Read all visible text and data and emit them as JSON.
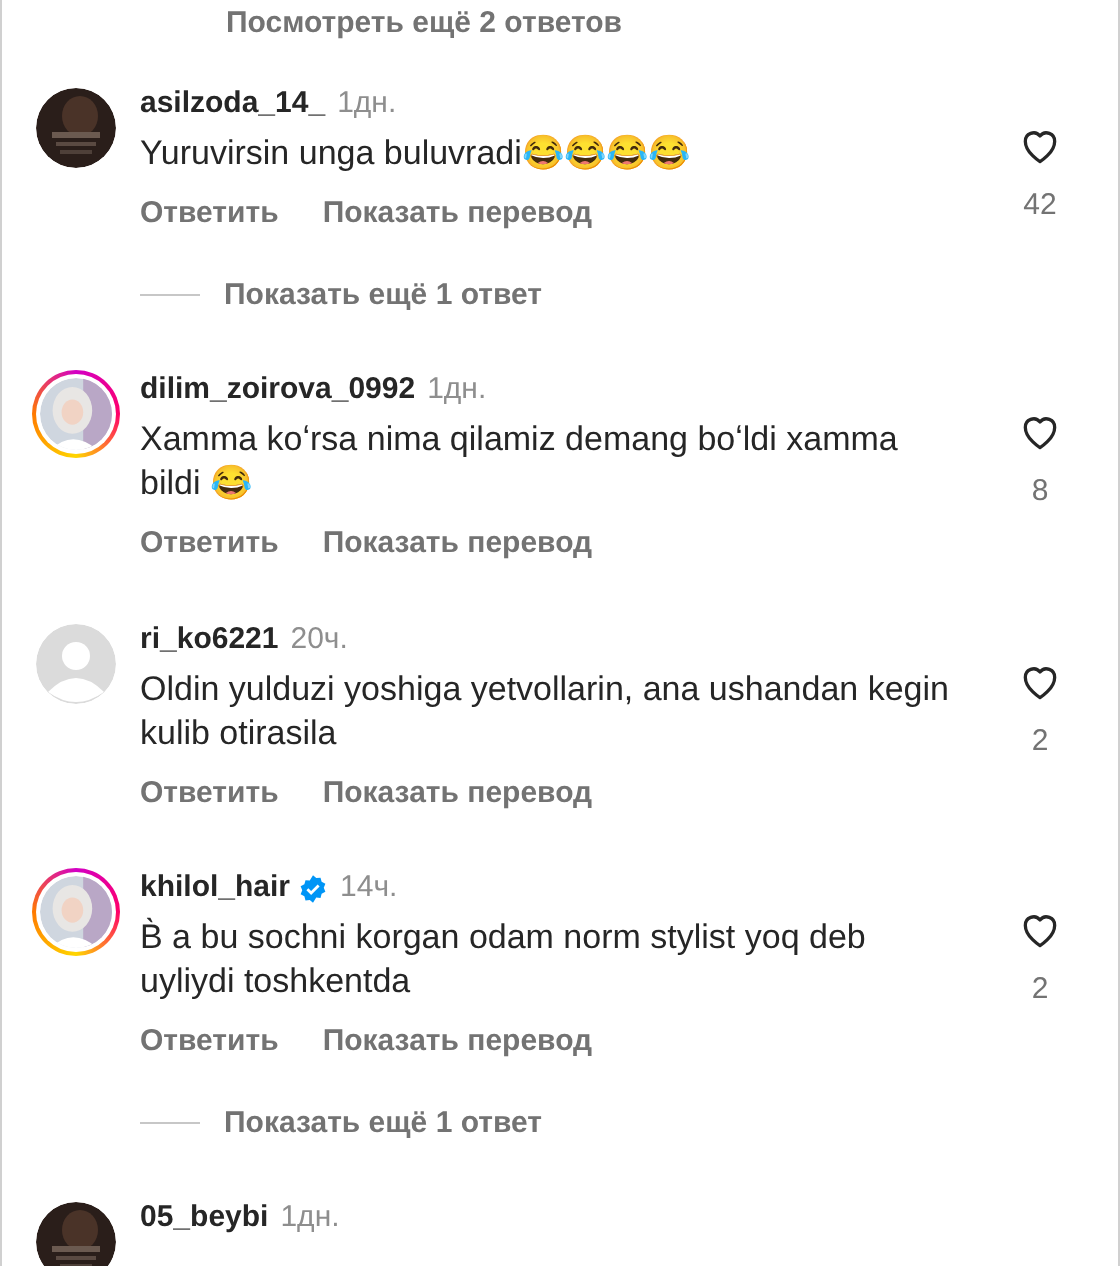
{
  "top_link": {
    "text": "Посмотреть ещё 2 ответов"
  },
  "comments": [
    {
      "username": "asilzoda_14_",
      "verified": false,
      "time": "1дн.",
      "text": "Yuruvirsin unga buluvradi😂😂😂😂",
      "likes": "42",
      "kind": "picture",
      "story_ring": false,
      "actions": [
        "Ответить",
        "Показать перевод"
      ],
      "more_replies": "Показать ещё 1 ответ"
    },
    {
      "username": "dilim_zoirova_0992",
      "verified": false,
      "time": "1дн.",
      "text": "Xamma koʻrsa nima qilamiz demang boʻldi xamma bildi 😂",
      "likes": "8",
      "kind": "picture",
      "story_ring": true,
      "actions": [
        "Ответить",
        "Показать перевод"
      ]
    },
    {
      "username": "ri_ko6221",
      "verified": false,
      "time": "20ч.",
      "text": "Oldin yulduzi yoshiga yetvollarin, ana ushandan kegin kulib otirasila",
      "likes": "2",
      "kind": "placeholder",
      "story_ring": false,
      "actions": [
        "Ответить",
        "Показать перевод"
      ]
    },
    {
      "username": "khilol_hair",
      "verified": true,
      "time": "14ч.",
      "text": "B̀  a bu sochni korgan odam norm stylist yoq deb uyliydi toshkentda",
      "likes": "2",
      "kind": "picture",
      "story_ring": true,
      "actions": [
        "Ответить",
        "Показать перевод"
      ],
      "more_replies": "Показать ещё 1 ответ"
    },
    {
      "username": "05_beybi",
      "verified": false,
      "time": "1дн.",
      "kind": "picture",
      "story_ring": false
    }
  ]
}
